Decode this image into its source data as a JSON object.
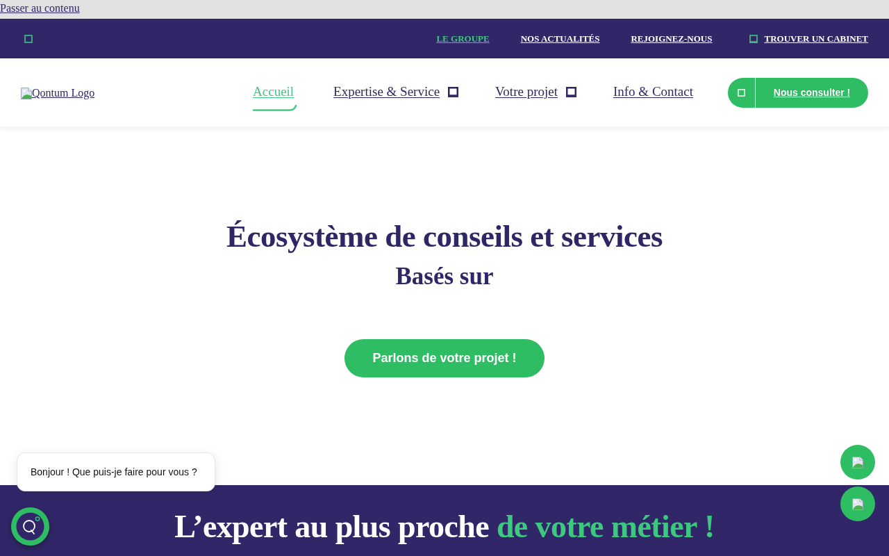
{
  "skip_link": "Passer au contenu",
  "top_bar": {
    "links": [
      {
        "label": "LE GROUPE",
        "selected": true,
        "icon": false
      },
      {
        "label": "NOS ACTUALITÉS",
        "selected": false,
        "icon": false
      },
      {
        "label": "REJOIGNEZ-NOUS",
        "selected": false,
        "icon": false
      },
      {
        "label": "TROUVER UN CABINET",
        "selected": false,
        "icon": true
      }
    ]
  },
  "header": {
    "logo_text": "Qontum Logo",
    "nav": [
      {
        "label": "Accueil",
        "selected": true,
        "has_menu": false
      },
      {
        "label": "Expertise & Service",
        "selected": false,
        "has_menu": true
      },
      {
        "label": "Votre projet",
        "selected": false,
        "has_menu": true
      },
      {
        "label": "Info & Contact",
        "selected": false,
        "has_menu": false
      }
    ],
    "cta": "Nous consulter !"
  },
  "hero": {
    "title": "Écosystème de conseils et services",
    "subtitle": "Basés sur",
    "button": "Parlons de votre projet !"
  },
  "expert_section": {
    "title_lead": "L’expert au plus proche",
    "title_highlight": "de votre métier !"
  },
  "chat": {
    "greeting": "Bonjour ! Que puis-je faire pour vous ?"
  }
}
